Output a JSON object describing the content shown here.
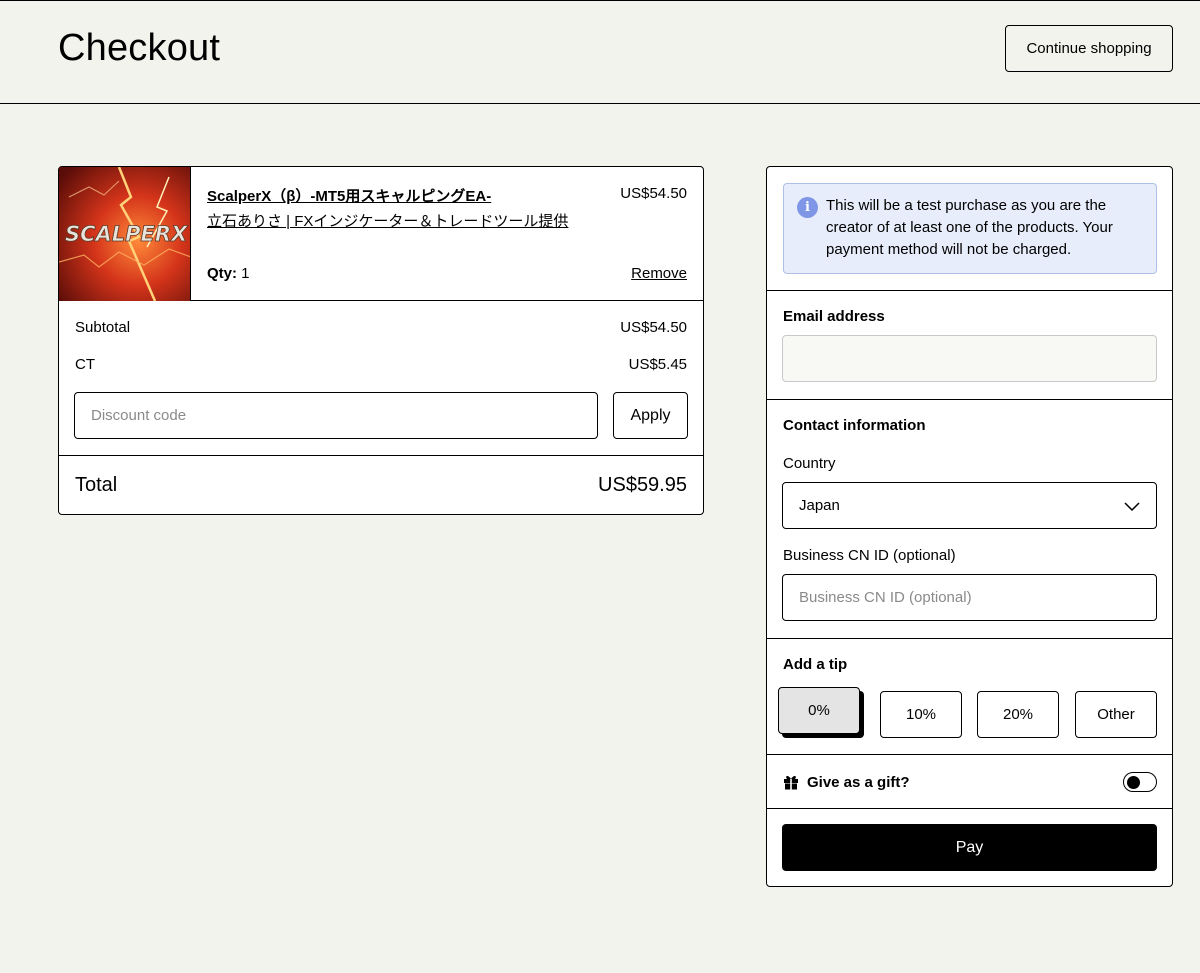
{
  "header": {
    "title": "Checkout",
    "continue_label": "Continue shopping"
  },
  "cart": {
    "item": {
      "thumbnail_text": "SCALPERX",
      "name": "ScalperX（β）-MT5用スキャルピングEA-",
      "seller": "立石ありさ | FXインジケーター＆トレードツール提供",
      "price": "US$54.50",
      "qty_label": "Qty:",
      "qty_value": "1",
      "remove_label": "Remove"
    },
    "subtotal_label": "Subtotal",
    "subtotal_value": "US$54.50",
    "tax_label": "CT",
    "tax_value": "US$5.45",
    "discount_placeholder": "Discount code",
    "discount_value": "",
    "apply_label": "Apply",
    "total_label": "Total",
    "total_value": "US$59.95"
  },
  "panel": {
    "notice": "This will be a test purchase as you are the creator of at least one of the products. Your payment method will not be charged.",
    "notice_icon": "info-icon",
    "email_label": "Email address",
    "email_value": "",
    "contact_label": "Contact information",
    "country_label": "Country",
    "country_value": "Japan",
    "cnid_label": "Business CN ID (optional)",
    "cnid_placeholder": "Business CN ID (optional)",
    "cnid_value": "",
    "tip_label": "Add a tip",
    "tips": [
      "0%",
      "10%",
      "20%",
      "Other"
    ],
    "tip_selected": "0%",
    "gift_label": "Give as a gift?",
    "gift_icon": "gift-icon",
    "gift_enabled": false,
    "pay_label": "Pay"
  },
  "colors": {
    "page_bg": "#f3f3ee",
    "notice_bg": "#e8edfb",
    "notice_icon": "#7f96e6",
    "pay_bg": "#000000",
    "tip_selected_bg": "#e4e4e4"
  }
}
